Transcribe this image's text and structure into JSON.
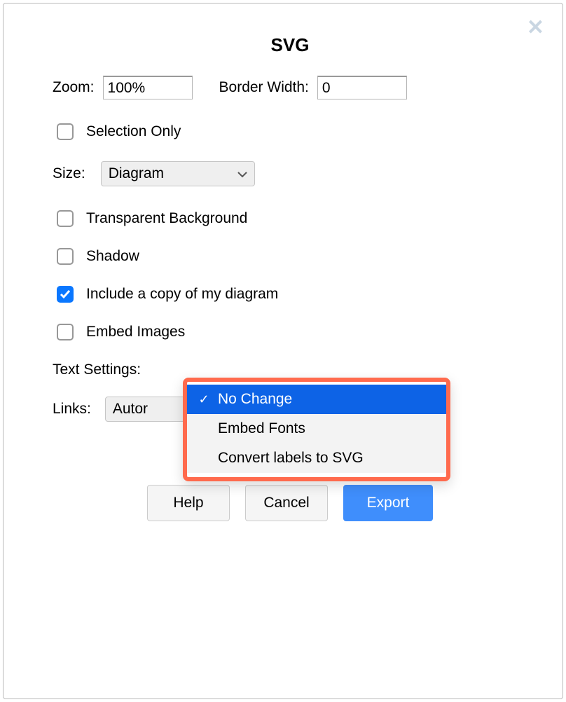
{
  "dialog": {
    "title": "SVG",
    "zoom_label": "Zoom:",
    "zoom_value": "100%",
    "border_label": "Border Width:",
    "border_value": "0",
    "selection_only": {
      "label": "Selection Only",
      "checked": false
    },
    "size_label": "Size:",
    "size_value": "Diagram",
    "transparent_bg": {
      "label": "Transparent Background",
      "checked": false
    },
    "shadow": {
      "label": "Shadow",
      "checked": false
    },
    "include_copy": {
      "label": "Include a copy of my diagram",
      "checked": true
    },
    "embed_images": {
      "label": "Embed Images",
      "checked": false
    },
    "text_settings_label": "Text Settings:",
    "text_settings_options": [
      {
        "label": "No Change",
        "selected": true
      },
      {
        "label": "Embed Fonts",
        "selected": false
      },
      {
        "label": "Convert labels to SVG",
        "selected": false
      }
    ],
    "links_label": "Links:",
    "links_value": "Autor",
    "buttons": {
      "help": "Help",
      "cancel": "Cancel",
      "export": "Export"
    }
  }
}
